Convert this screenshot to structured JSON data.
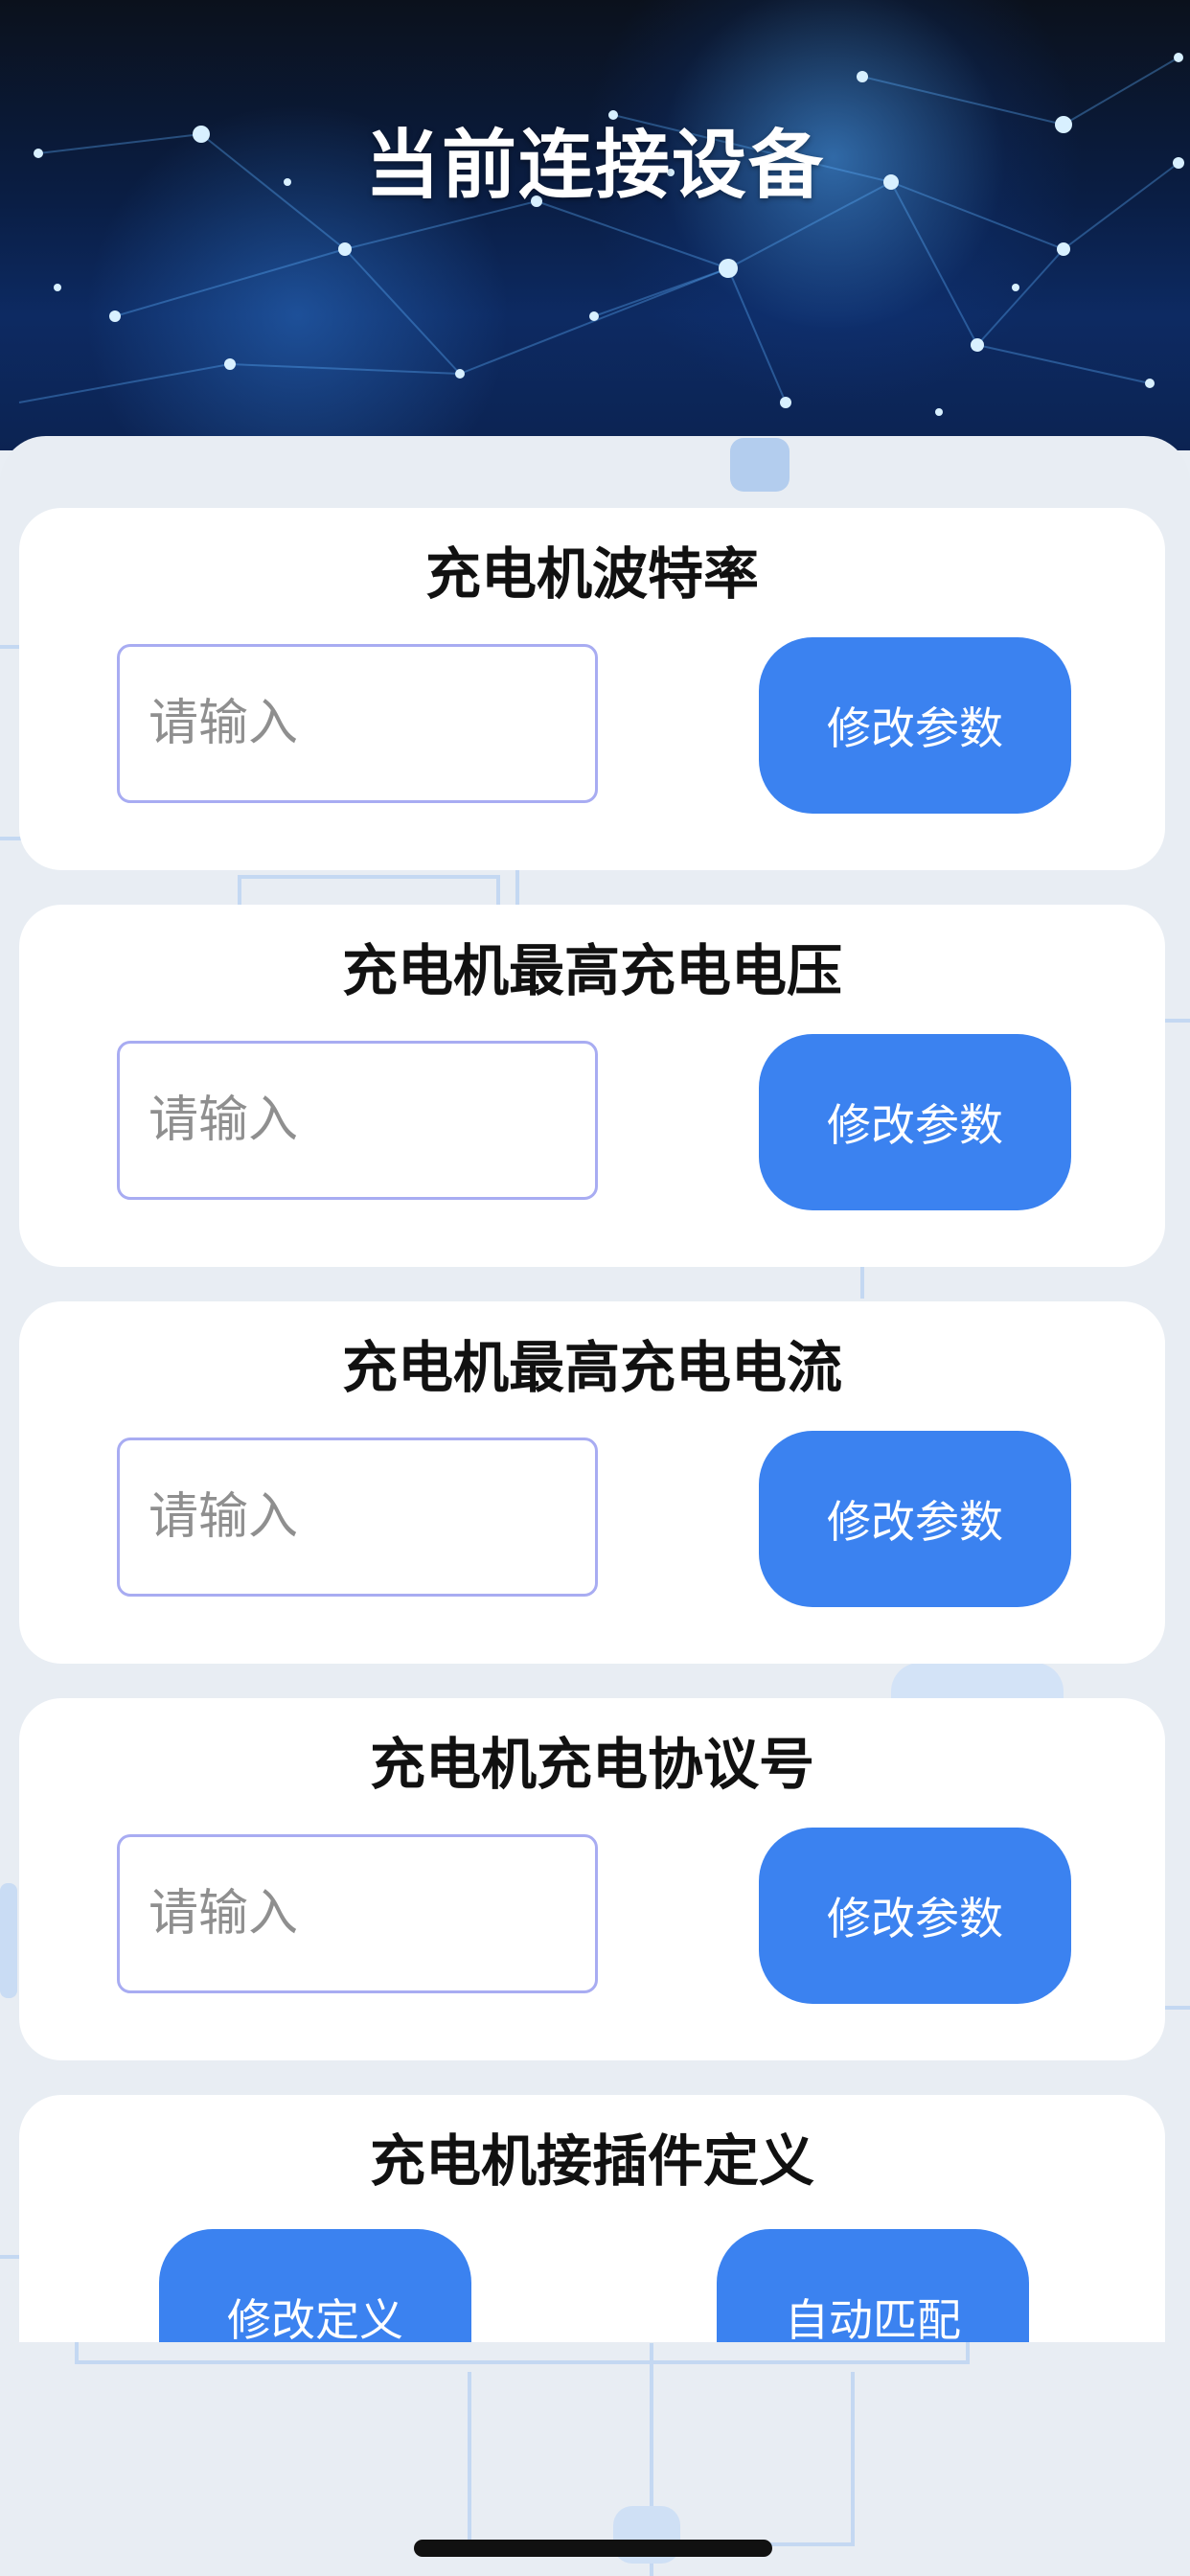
{
  "header": {
    "title": "当前连接设备"
  },
  "cards": [
    {
      "title": "充电机波特率",
      "input_placeholder": "请输入",
      "button_label": "修改参数"
    },
    {
      "title": "充电机最高充电电压",
      "input_placeholder": "请输入",
      "button_label": "修改参数"
    },
    {
      "title": "充电机最高充电电流",
      "input_placeholder": "请输入",
      "button_label": "修改参数"
    },
    {
      "title": "充电机充电协议号",
      "input_placeholder": "请输入",
      "button_label": "修改参数"
    }
  ],
  "connector_card": {
    "title": "充电机接插件定义",
    "modify_label": "修改定义",
    "auto_match_label": "自动匹配"
  },
  "colors": {
    "accent": "#3b82f0",
    "input_border": "#a8acf2",
    "sheet_background": "#e8edf3"
  }
}
